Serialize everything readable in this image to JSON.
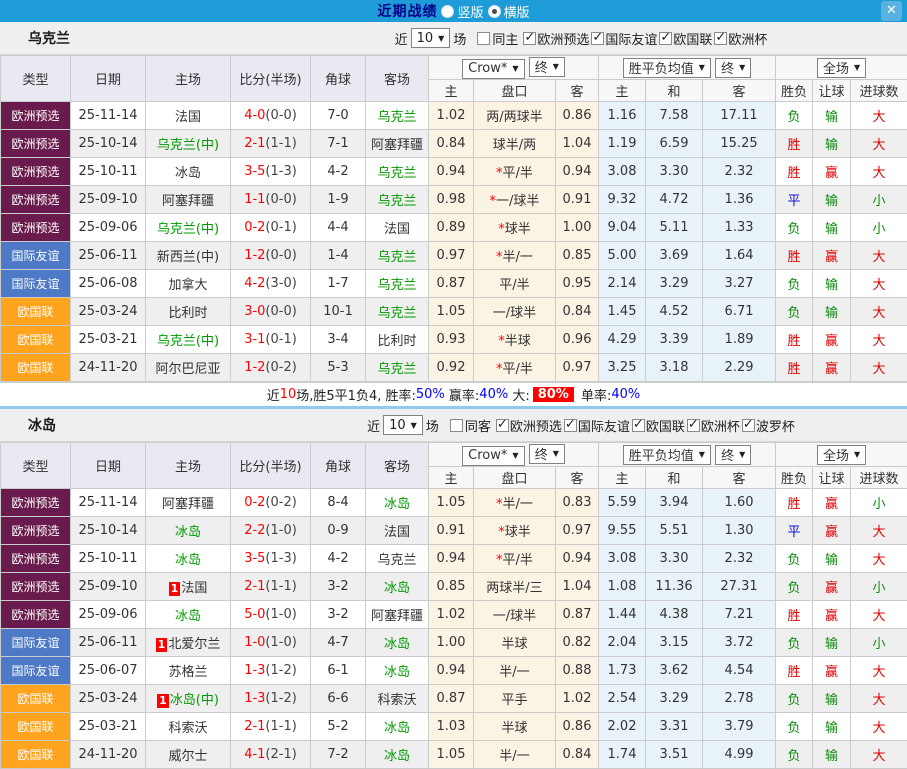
{
  "topbar": {
    "title": "近期战绩",
    "vertical_label": "竖版",
    "horizontal_label": "横版",
    "selected_layout": "横版"
  },
  "icons": {
    "chevron_down": "▼",
    "close": "✕",
    "check": "✓"
  },
  "table_columns": {
    "type": "类型",
    "date": "日期",
    "home": "主场",
    "score": "比分(半场)",
    "corner": "角球",
    "away": "客场",
    "bookmaker": "Crow*",
    "final": "终",
    "avg_label": "胜平负均值",
    "final2": "终",
    "scope": "全场",
    "sub_home": "主",
    "sub_handicap": "盘口",
    "sub_away": "客",
    "sub_avg_home": "主",
    "sub_avg_draw": "和",
    "sub_avg_away": "客",
    "sub_wdl": "胜负",
    "sub_let": "让球",
    "sub_goals": "进球数"
  },
  "palette": {
    "topbar_blue": "#1E9CD8",
    "title_navy": "#00008B",
    "type_colors": {
      "欧洲预选": "#6A1B4D",
      "国际友谊": "#4E79C6",
      "欧国联": "#FFA41F"
    },
    "team_green": "#009900",
    "score_red": "#FF0000",
    "result_colors": {
      "胜": "#DF0000",
      "赢": "#DF0000",
      "大": "#DF0000",
      "平": "#1010D0",
      "负": "#0E8A0E",
      "输": "#0E8A0E",
      "小": "#0E8A0E"
    },
    "cream_bg": "#FBF3E4",
    "lightblue_bg": "#E8F3F9"
  },
  "sections": [
    {
      "team": "乌克兰",
      "near_label": "近",
      "near_value": "10",
      "games_label": "场",
      "same_label": "同主",
      "same_checked": false,
      "competitions": [
        "欧洲预选",
        "国际友谊",
        "欧国联",
        "欧洲杯"
      ],
      "rows": [
        {
          "type": "欧洲预选",
          "date": "25-11-14",
          "home": "法国",
          "hg": false,
          "badge": "",
          "score": "4-0",
          "half": "(0-0)",
          "corner": "7-0",
          "away": "乌克兰",
          "ag": true,
          "o1": "1.02",
          "star": "",
          "pan": "两/两球半",
          "o2": "0.86",
          "a1": "1.16",
          "a2": "7.58",
          "a3": "17.11",
          "r1": "负",
          "r2": "输",
          "r3": "大"
        },
        {
          "type": "欧洲预选",
          "date": "25-10-14",
          "home": "乌克兰(中)",
          "hg": true,
          "badge": "",
          "score": "2-1",
          "half": "(1-1)",
          "corner": "7-1",
          "away": "阿塞拜疆",
          "ag": false,
          "o1": "0.84",
          "star": "",
          "pan": "球半/两",
          "o2": "1.04",
          "a1": "1.19",
          "a2": "6.59",
          "a3": "15.25",
          "r1": "胜",
          "r2": "输",
          "r3": "大"
        },
        {
          "type": "欧洲预选",
          "date": "25-10-11",
          "home": "冰岛",
          "hg": false,
          "badge": "",
          "score": "3-5",
          "half": "(1-3)",
          "corner": "4-2",
          "away": "乌克兰",
          "ag": true,
          "o1": "0.94",
          "star": "*",
          "pan": "平/半",
          "o2": "0.94",
          "a1": "3.08",
          "a2": "3.30",
          "a3": "2.32",
          "r1": "胜",
          "r2": "赢",
          "r3": "大"
        },
        {
          "type": "欧洲预选",
          "date": "25-09-10",
          "home": "阿塞拜疆",
          "hg": false,
          "badge": "",
          "score": "1-1",
          "half": "(0-0)",
          "corner": "1-9",
          "away": "乌克兰",
          "ag": true,
          "o1": "0.98",
          "star": "*",
          "pan": "一/球半",
          "o2": "0.91",
          "a1": "9.32",
          "a2": "4.72",
          "a3": "1.36",
          "r1": "平",
          "r2": "输",
          "r3": "小"
        },
        {
          "type": "欧洲预选",
          "date": "25-09-06",
          "home": "乌克兰(中)",
          "hg": true,
          "badge": "",
          "score": "0-2",
          "half": "(0-1)",
          "corner": "4-4",
          "away": "法国",
          "ag": false,
          "o1": "0.89",
          "star": "*",
          "pan": "球半",
          "o2": "1.00",
          "a1": "9.04",
          "a2": "5.11",
          "a3": "1.33",
          "r1": "负",
          "r2": "输",
          "r3": "小"
        },
        {
          "type": "国际友谊",
          "date": "25-06-11",
          "home": "新西兰(中)",
          "hg": false,
          "badge": "",
          "score": "1-2",
          "half": "(0-0)",
          "corner": "1-4",
          "away": "乌克兰",
          "ag": true,
          "o1": "0.97",
          "star": "*",
          "pan": "半/一",
          "o2": "0.85",
          "a1": "5.00",
          "a2": "3.69",
          "a3": "1.64",
          "r1": "胜",
          "r2": "赢",
          "r3": "大"
        },
        {
          "type": "国际友谊",
          "date": "25-06-08",
          "home": "加拿大",
          "hg": false,
          "badge": "",
          "score": "4-2",
          "half": "(3-0)",
          "corner": "1-7",
          "away": "乌克兰",
          "ag": true,
          "o1": "0.87",
          "star": "",
          "pan": "平/半",
          "o2": "0.95",
          "a1": "2.14",
          "a2": "3.29",
          "a3": "3.27",
          "r1": "负",
          "r2": "输",
          "r3": "大"
        },
        {
          "type": "欧国联",
          "date": "25-03-24",
          "home": "比利时",
          "hg": false,
          "badge": "",
          "score": "3-0",
          "half": "(0-0)",
          "corner": "10-1",
          "away": "乌克兰",
          "ag": true,
          "o1": "1.05",
          "star": "",
          "pan": "一/球半",
          "o2": "0.84",
          "a1": "1.45",
          "a2": "4.52",
          "a3": "6.71",
          "r1": "负",
          "r2": "输",
          "r3": "大"
        },
        {
          "type": "欧国联",
          "date": "25-03-21",
          "home": "乌克兰(中)",
          "hg": true,
          "badge": "",
          "score": "3-1",
          "half": "(0-1)",
          "corner": "3-4",
          "away": "比利时",
          "ag": false,
          "o1": "0.93",
          "star": "*",
          "pan": "半球",
          "o2": "0.96",
          "a1": "4.29",
          "a2": "3.39",
          "a3": "1.89",
          "r1": "胜",
          "r2": "赢",
          "r3": "大"
        },
        {
          "type": "欧国联",
          "date": "24-11-20",
          "home": "阿尔巴尼亚",
          "hg": false,
          "badge": "",
          "score": "1-2",
          "half": "(0-2)",
          "corner": "5-3",
          "away": "乌克兰",
          "ag": true,
          "o1": "0.92",
          "star": "*",
          "pan": "平/半",
          "o2": "0.97",
          "a1": "3.25",
          "a2": "3.18",
          "a3": "2.29",
          "r1": "胜",
          "r2": "赢",
          "r3": "大"
        }
      ],
      "summary_parts": [
        {
          "t": "近",
          "s": "plain"
        },
        {
          "t": "10",
          "s": "red"
        },
        {
          "t": "场,胜5平1负4, 胜率:",
          "s": "plain"
        },
        {
          "t": "50%",
          "s": "blue"
        },
        {
          "t": " 赢率:",
          "s": "plain"
        },
        {
          "t": "40%",
          "s": "blue"
        },
        {
          "t": " 大:",
          "s": "plain"
        },
        {
          "t": "80%",
          "s": "redbox"
        },
        {
          "t": " 单率:",
          "s": "plain"
        },
        {
          "t": "40%",
          "s": "blue"
        }
      ]
    },
    {
      "team": "冰岛",
      "near_label": "近",
      "near_value": "10",
      "games_label": "场",
      "same_label": "同客",
      "same_checked": false,
      "competitions": [
        "欧洲预选",
        "国际友谊",
        "欧国联",
        "欧洲杯",
        "波罗杯"
      ],
      "rows": [
        {
          "type": "欧洲预选",
          "date": "25-11-14",
          "home": "阿塞拜疆",
          "hg": false,
          "badge": "",
          "score": "0-2",
          "half": "(0-2)",
          "corner": "8-4",
          "away": "冰岛",
          "ag": true,
          "o1": "1.05",
          "star": "*",
          "pan": "半/一",
          "o2": "0.83",
          "a1": "5.59",
          "a2": "3.94",
          "a3": "1.60",
          "r1": "胜",
          "r2": "赢",
          "r3": "小"
        },
        {
          "type": "欧洲预选",
          "date": "25-10-14",
          "home": "冰岛",
          "hg": true,
          "badge": "",
          "score": "2-2",
          "half": "(1-0)",
          "corner": "0-9",
          "away": "法国",
          "ag": false,
          "o1": "0.91",
          "star": "*",
          "pan": "球半",
          "o2": "0.97",
          "a1": "9.55",
          "a2": "5.51",
          "a3": "1.30",
          "r1": "平",
          "r2": "赢",
          "r3": "大"
        },
        {
          "type": "欧洲预选",
          "date": "25-10-11",
          "home": "冰岛",
          "hg": true,
          "badge": "",
          "score": "3-5",
          "half": "(1-3)",
          "corner": "4-2",
          "away": "乌克兰",
          "ag": false,
          "o1": "0.94",
          "star": "*",
          "pan": "平/半",
          "o2": "0.94",
          "a1": "3.08",
          "a2": "3.30",
          "a3": "2.32",
          "r1": "负",
          "r2": "输",
          "r3": "大"
        },
        {
          "type": "欧洲预选",
          "date": "25-09-10",
          "home": "法国",
          "hg": false,
          "badge": "1",
          "score": "2-1",
          "half": "(1-1)",
          "corner": "3-2",
          "away": "冰岛",
          "ag": true,
          "o1": "0.85",
          "star": "",
          "pan": "两球半/三",
          "o2": "1.04",
          "a1": "1.08",
          "a2": "11.36",
          "a3": "27.31",
          "r1": "负",
          "r2": "赢",
          "r3": "小"
        },
        {
          "type": "欧洲预选",
          "date": "25-09-06",
          "home": "冰岛",
          "hg": true,
          "badge": "",
          "score": "5-0",
          "half": "(1-0)",
          "corner": "3-2",
          "away": "阿塞拜疆",
          "ag": false,
          "o1": "1.02",
          "star": "",
          "pan": "一/球半",
          "o2": "0.87",
          "a1": "1.44",
          "a2": "4.38",
          "a3": "7.21",
          "r1": "胜",
          "r2": "赢",
          "r3": "大"
        },
        {
          "type": "国际友谊",
          "date": "25-06-11",
          "home": "北爱尔兰",
          "hg": false,
          "badge": "1",
          "score": "1-0",
          "half": "(1-0)",
          "corner": "4-7",
          "away": "冰岛",
          "ag": true,
          "o1": "1.00",
          "star": "",
          "pan": "半球",
          "o2": "0.82",
          "a1": "2.04",
          "a2": "3.15",
          "a3": "3.72",
          "r1": "负",
          "r2": "输",
          "r3": "小"
        },
        {
          "type": "国际友谊",
          "date": "25-06-07",
          "home": "苏格兰",
          "hg": false,
          "badge": "",
          "score": "1-3",
          "half": "(1-2)",
          "corner": "6-1",
          "away": "冰岛",
          "ag": true,
          "o1": "0.94",
          "star": "",
          "pan": "半/一",
          "o2": "0.88",
          "a1": "1.73",
          "a2": "3.62",
          "a3": "4.54",
          "r1": "胜",
          "r2": "赢",
          "r3": "大"
        },
        {
          "type": "欧国联",
          "date": "25-03-24",
          "home": "冰岛(中)",
          "hg": true,
          "badge": "1",
          "score": "1-3",
          "half": "(1-2)",
          "corner": "6-6",
          "away": "科索沃",
          "ag": false,
          "o1": "0.87",
          "star": "",
          "pan": "平手",
          "o2": "1.02",
          "a1": "2.54",
          "a2": "3.29",
          "a3": "2.78",
          "r1": "负",
          "r2": "输",
          "r3": "大"
        },
        {
          "type": "欧国联",
          "date": "25-03-21",
          "home": "科索沃",
          "hg": false,
          "badge": "",
          "score": "2-1",
          "half": "(1-1)",
          "corner": "5-2",
          "away": "冰岛",
          "ag": true,
          "o1": "1.03",
          "star": "",
          "pan": "半球",
          "o2": "0.86",
          "a1": "2.02",
          "a2": "3.31",
          "a3": "3.79",
          "r1": "负",
          "r2": "输",
          "r3": "大"
        },
        {
          "type": "欧国联",
          "date": "24-11-20",
          "home": "威尔士",
          "hg": false,
          "badge": "",
          "score": "4-1",
          "half": "(2-1)",
          "corner": "7-2",
          "away": "冰岛",
          "ag": true,
          "o1": "1.05",
          "star": "",
          "pan": "半/一",
          "o2": "0.84",
          "a1": "1.74",
          "a2": "3.51",
          "a3": "4.99",
          "r1": "负",
          "r2": "输",
          "r3": "大"
        }
      ]
    }
  ]
}
